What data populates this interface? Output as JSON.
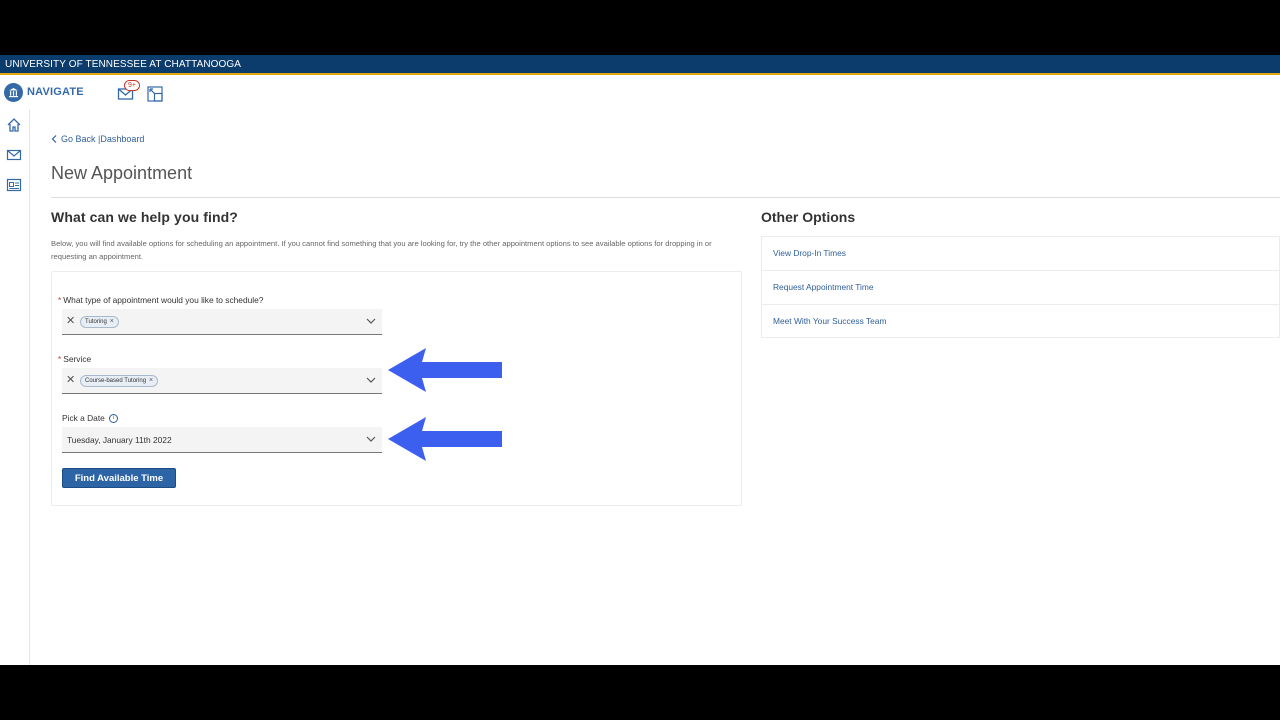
{
  "university": {
    "name": "UNIVERSITY OF TENNESSEE AT CHATTANOOGA"
  },
  "app": {
    "name": "NAVIGATE",
    "notification_count": "9+"
  },
  "breadcrumb": {
    "back_label": "Go Back |Dashboard"
  },
  "page": {
    "title": "New Appointment"
  },
  "help": {
    "heading": "What can we help you find?",
    "description": "Below, you will find available options for scheduling an appointment. If you cannot find something that you are looking for, try the other appointment options to see available options for dropping in or requesting an appointment."
  },
  "form": {
    "appointment_type": {
      "label": "What type of appointment would you like to schedule?",
      "selected": "Tutoring"
    },
    "service": {
      "label": "Service",
      "selected": "Course-based Tutoring"
    },
    "date": {
      "label": "Pick a Date",
      "value": "Tuesday, January 11th 2022"
    },
    "submit_label": "Find Available Time"
  },
  "other_options": {
    "heading": "Other Options",
    "items": [
      {
        "label": "View Drop-In Times"
      },
      {
        "label": "Request Appointment Time"
      },
      {
        "label": "Meet With Your Success Team"
      }
    ]
  },
  "icons": {
    "logo": "building-icon",
    "mail": "mail-icon",
    "switch": "switch-view-icon",
    "nav": [
      "home-icon",
      "mail-icon",
      "id-card-icon"
    ],
    "chevron": "chevron-down-icon",
    "info": "info-icon",
    "arrow": "left-arrow-annotation"
  },
  "colors": {
    "brand_navy": "#0c3c6c",
    "brand_gold": "#e0aa0f",
    "link_blue": "#2f5f9a",
    "button_blue": "#2d64a5",
    "arrow_blue": "#3d5ff0",
    "required_red": "#c8372d"
  }
}
